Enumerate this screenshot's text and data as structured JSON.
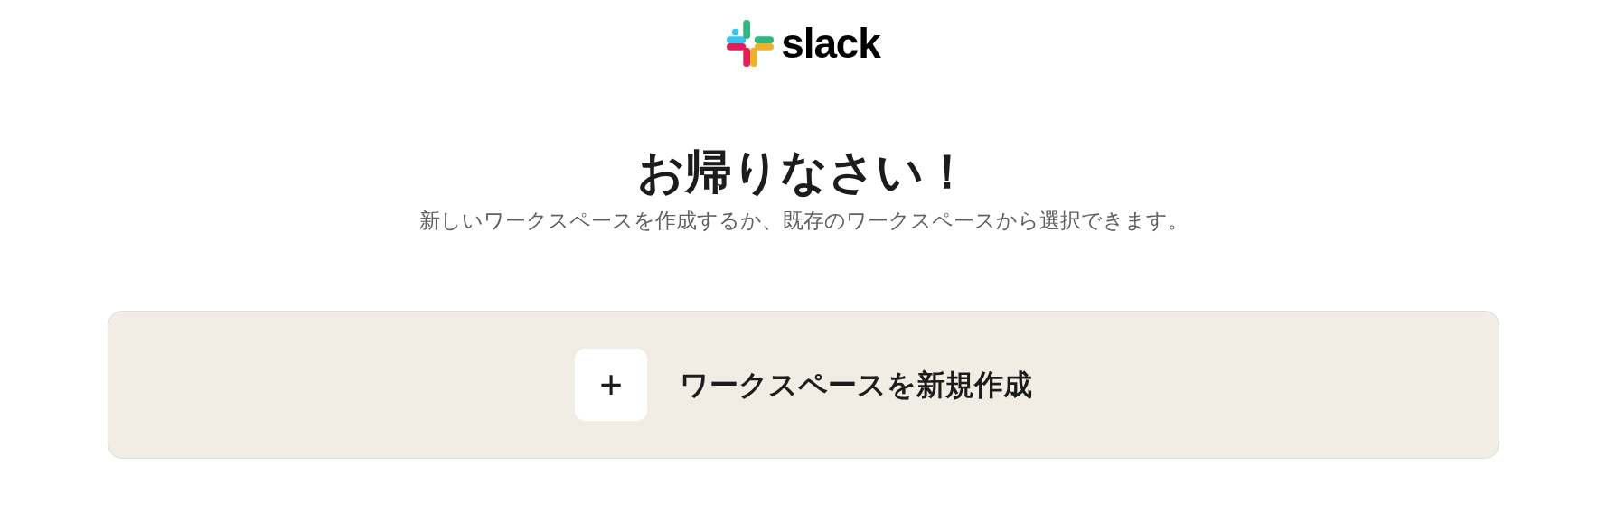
{
  "logo": {
    "wordmark": "slack"
  },
  "heading": "お帰りなさい！",
  "subtitle": "新しいワークスペースを作成するか、既存のワークスペースから選択できます。",
  "create_card": {
    "icon": "+",
    "label": "ワークスペースを新規作成"
  }
}
